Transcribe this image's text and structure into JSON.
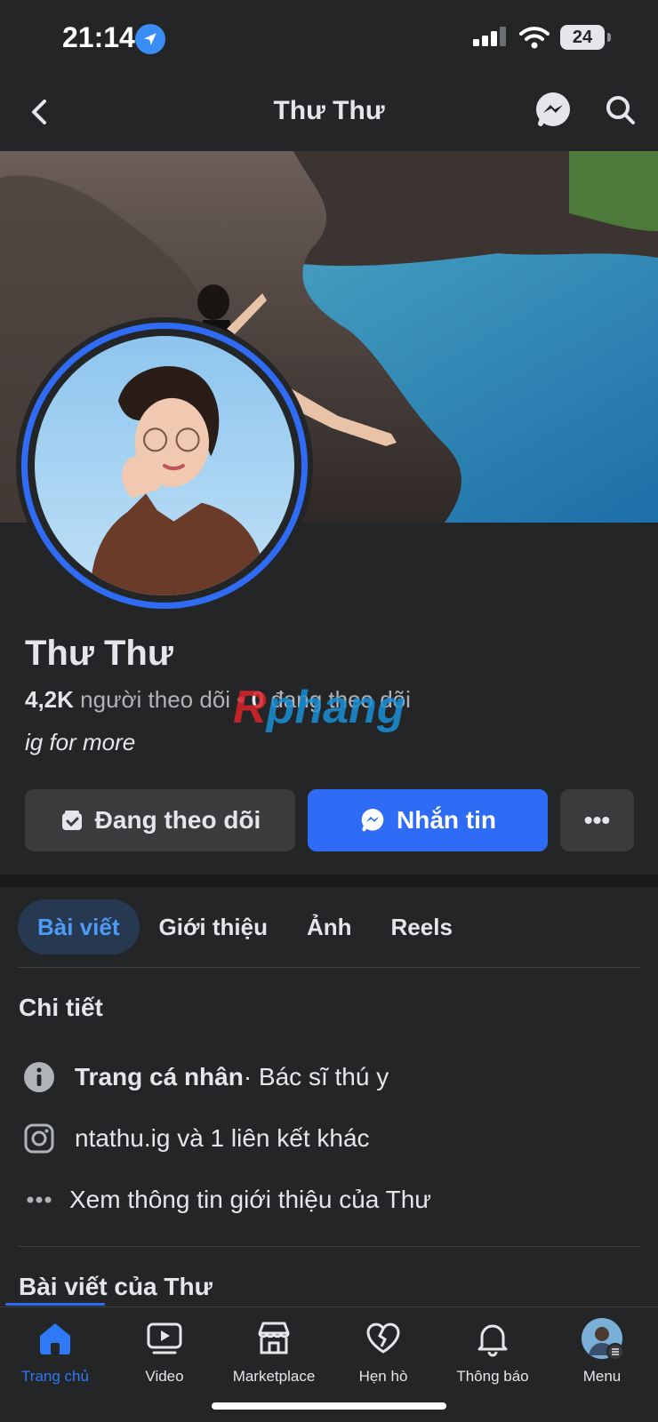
{
  "status_bar": {
    "time": "21:14",
    "battery": "24"
  },
  "nav": {
    "title": "Thư Thư"
  },
  "profile": {
    "name": "Thư Thư",
    "followers_count": "4,2K",
    "followers_label": "người theo dõi",
    "following_count": "0",
    "following_label": "đang theo dõi",
    "bio": "ig for more"
  },
  "watermark": {
    "text_a": "R",
    "text_b": "phang"
  },
  "actions": {
    "following_label": "Đang theo dõi",
    "message_label": "Nhắn tin",
    "more_label": "•••"
  },
  "tabs": [
    {
      "label": "Bài viết",
      "active": true
    },
    {
      "label": "Giới thiệu",
      "active": false
    },
    {
      "label": "Ảnh",
      "active": false
    },
    {
      "label": "Reels",
      "active": false
    }
  ],
  "details": {
    "title": "Chi tiết",
    "page_type_bold": "Trang cá nhân",
    "page_type_rest": " · Bác sĩ thú y",
    "links": "ntathu.ig và 1 liên kết khác",
    "see_about": "Xem thông tin giới thiệu của Thư"
  },
  "posts": {
    "title": "Bài viết của Thư"
  },
  "bottom_nav": [
    {
      "label": "Trang chủ",
      "icon": "home-icon",
      "active": true
    },
    {
      "label": "Video",
      "icon": "video-icon",
      "active": false
    },
    {
      "label": "Marketplace",
      "icon": "marketplace-icon",
      "active": false
    },
    {
      "label": "Hẹn hò",
      "icon": "dating-heart-icon",
      "active": false
    },
    {
      "label": "Thông báo",
      "icon": "bell-icon",
      "active": false
    },
    {
      "label": "Menu",
      "icon": "menu-avatar-icon",
      "active": false
    }
  ],
  "colors": {
    "accent": "#2e6cf5",
    "background": "#242526",
    "active_tab_bg": "#263951"
  }
}
